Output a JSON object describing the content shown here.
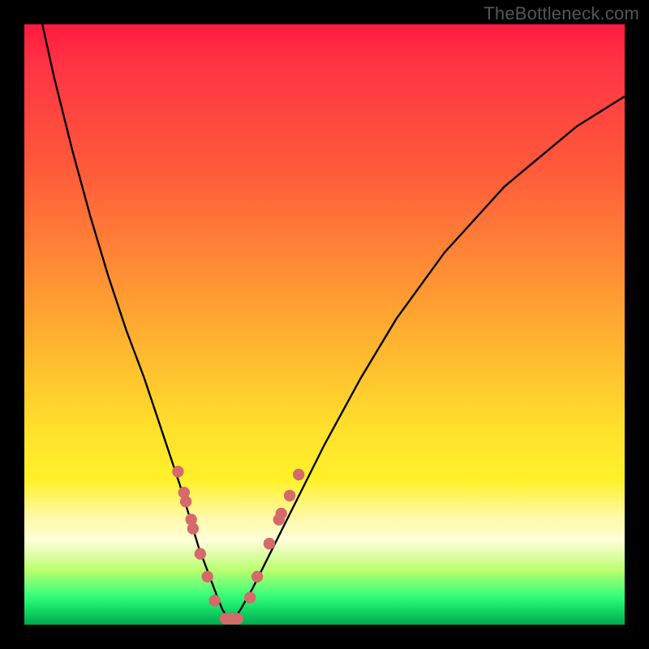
{
  "watermark": "TheBottleneck.com",
  "colors": {
    "frame": "#000000",
    "curve_stroke": "#000000",
    "marker_fill": "#d46a6a",
    "gradient_top": "#ff1a3e",
    "gradient_bottom": "#00a84f"
  },
  "chart_data": {
    "type": "line",
    "title": "",
    "xlabel": "",
    "ylabel": "",
    "xlim": [
      0,
      100
    ],
    "ylim": [
      0,
      100
    ],
    "grid": false,
    "legend": false,
    "series": [
      {
        "name": "bottleneck-v-curve",
        "x": [
          3,
          5,
          8,
          11,
          14,
          17,
          20,
          22,
          24,
          26,
          27.5,
          29,
          30.5,
          32,
          33,
          34,
          35,
          36,
          38,
          41,
          45,
          50,
          56,
          62,
          70,
          80,
          92,
          100
        ],
        "y": [
          100,
          91,
          79,
          68,
          58,
          49,
          41,
          35,
          29,
          23,
          18,
          13,
          9,
          5,
          2.5,
          1,
          1,
          2.5,
          6,
          12,
          20,
          30,
          41,
          51,
          62,
          73,
          83,
          88
        ]
      }
    ],
    "markers": [
      {
        "x": 25.6,
        "y": 25.5
      },
      {
        "x": 26.6,
        "y": 22.0
      },
      {
        "x": 26.9,
        "y": 20.5
      },
      {
        "x": 27.8,
        "y": 17.5
      },
      {
        "x": 28.1,
        "y": 16.0
      },
      {
        "x": 29.3,
        "y": 11.8
      },
      {
        "x": 30.5,
        "y": 8.0
      },
      {
        "x": 31.7,
        "y": 4.0
      },
      {
        "x": 33.5,
        "y": 1.0
      },
      {
        "x": 34.5,
        "y": 1.0
      },
      {
        "x": 35.5,
        "y": 1.0
      },
      {
        "x": 37.6,
        "y": 4.5
      },
      {
        "x": 38.8,
        "y": 8.0
      },
      {
        "x": 40.8,
        "y": 13.5
      },
      {
        "x": 42.4,
        "y": 17.5
      },
      {
        "x": 42.8,
        "y": 18.5
      },
      {
        "x": 44.2,
        "y": 21.5
      },
      {
        "x": 45.7,
        "y": 25.0
      }
    ]
  }
}
